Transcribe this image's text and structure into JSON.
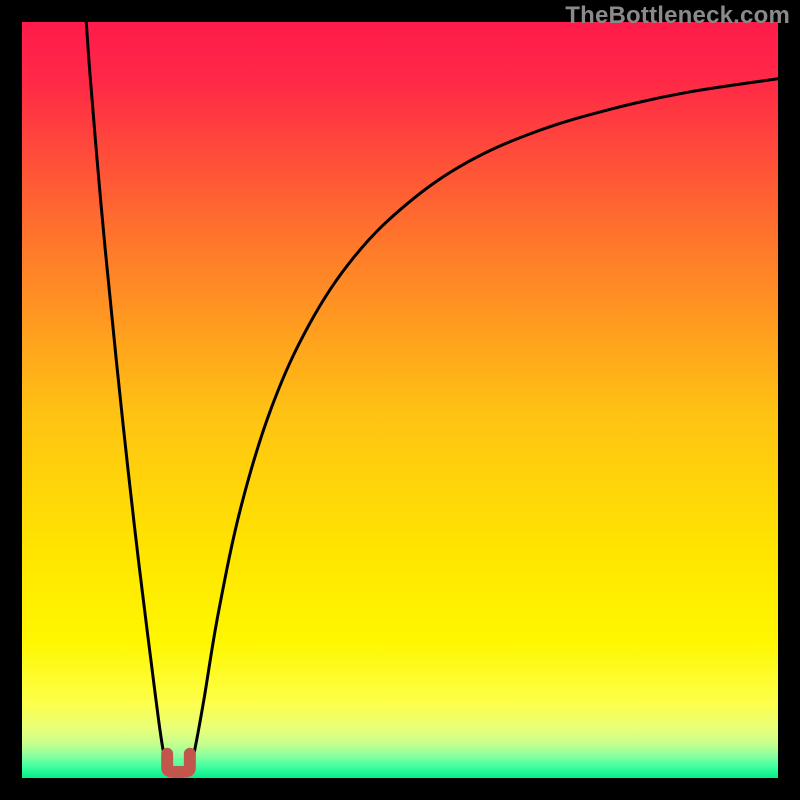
{
  "watermark": "TheBottleneck.com",
  "chart_data": {
    "type": "line",
    "title": "",
    "xlabel": "",
    "ylabel": "",
    "xlim": [
      0,
      100
    ],
    "ylim": [
      0,
      100
    ],
    "background_gradient_stops": [
      {
        "offset": 0.0,
        "color": "#ff1b4b"
      },
      {
        "offset": 0.08,
        "color": "#ff2946"
      },
      {
        "offset": 0.3,
        "color": "#ff7a2a"
      },
      {
        "offset": 0.52,
        "color": "#ffc313"
      },
      {
        "offset": 0.7,
        "color": "#ffe500"
      },
      {
        "offset": 0.82,
        "color": "#fff700"
      },
      {
        "offset": 0.9,
        "color": "#fdff4a"
      },
      {
        "offset": 0.935,
        "color": "#e8ff7a"
      },
      {
        "offset": 0.955,
        "color": "#c5ff8e"
      },
      {
        "offset": 0.97,
        "color": "#8cffa0"
      },
      {
        "offset": 0.985,
        "color": "#40ffa0"
      },
      {
        "offset": 1.0,
        "color": "#00ef88"
      }
    ],
    "series": [
      {
        "name": "left-branch",
        "x": [
          8.5,
          9.0,
          10.0,
          11.0,
          12.5,
          14.0,
          15.5,
          17.0,
          18.3,
          19.0,
          19.5
        ],
        "y": [
          100,
          93,
          81,
          70,
          55,
          41,
          28,
          16,
          6,
          2,
          0.5
        ]
      },
      {
        "name": "right-branch",
        "x": [
          22.0,
          22.7,
          24.0,
          26.0,
          29.0,
          33.0,
          38.0,
          44.0,
          51.0,
          59.0,
          68.0,
          78.0,
          88.0,
          100.0
        ],
        "y": [
          0.5,
          3,
          10,
          22,
          36,
          49,
          60,
          69,
          76,
          81.5,
          85.5,
          88.5,
          90.7,
          92.5
        ]
      }
    ],
    "minimum_marker": {
      "x_range": [
        19.2,
        22.2
      ],
      "y": 0.8,
      "color": "#c2564d"
    }
  }
}
